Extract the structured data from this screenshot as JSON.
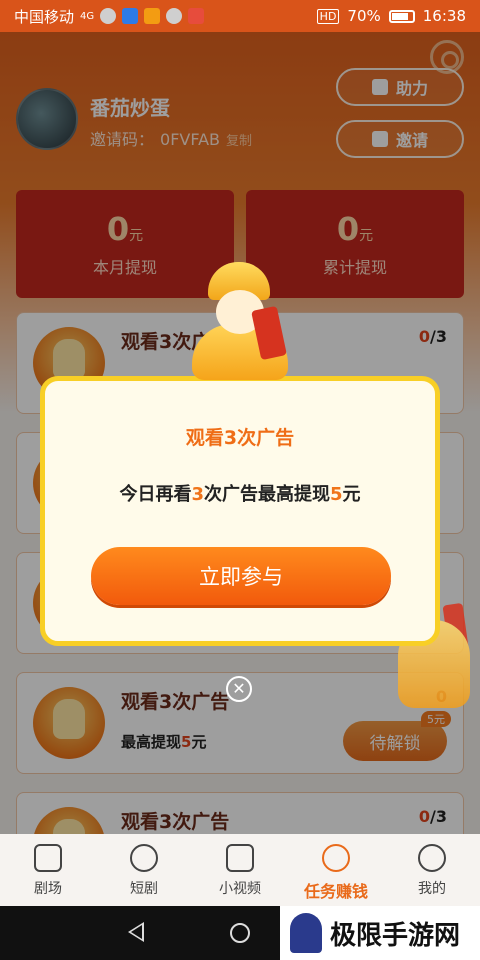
{
  "status_bar": {
    "carrier": "中国移动",
    "network": "4G",
    "battery": "70%",
    "time": "16:38",
    "hd_label": "HD"
  },
  "profile": {
    "username": "番茄炒蛋",
    "invite_label": "邀请码：",
    "invite_code": "0FVFAB",
    "copy_label": "复制"
  },
  "actions": {
    "help_label": "助力",
    "invite_label": "邀请"
  },
  "stats": [
    {
      "value": "0",
      "unit": "元",
      "label": "本月提现"
    },
    {
      "value": "0",
      "unit": "元",
      "label": "累计提现"
    }
  ],
  "tasks": [
    {
      "title": "观看3次广告",
      "progress_done": "0",
      "progress_total": "/3"
    },
    {
      "title": "观看3次广告",
      "sub_prefix": "最高提现",
      "sub_value": "5",
      "sub_unit": "元",
      "progress_done": "0",
      "button": "待解锁",
      "tag": "5元"
    },
    {
      "title": "观看3次广告",
      "progress_done": "0",
      "progress_total": "/3"
    }
  ],
  "dialog": {
    "title": "观看3次广告",
    "desc_prefix": "今日再看",
    "desc_count": "3",
    "desc_middle": "次广告最高提现",
    "desc_amount": "5",
    "desc_unit": "元",
    "button": "立即参与"
  },
  "tabbar": {
    "items": [
      {
        "label": "剧场",
        "icon": "film-icon"
      },
      {
        "label": "短剧",
        "icon": "play-icon"
      },
      {
        "label": "小视频",
        "icon": "video-camera-icon"
      },
      {
        "label": "任务赚钱",
        "icon": "money-hand-icon"
      },
      {
        "label": "我的",
        "icon": "person-icon"
      }
    ]
  },
  "watermark": {
    "text": "极限手游网"
  },
  "colors": {
    "accent": "#e96a1a",
    "card_red": "#c4271e",
    "dialog_border": "#f8cf26",
    "highlight": "#f07419"
  }
}
